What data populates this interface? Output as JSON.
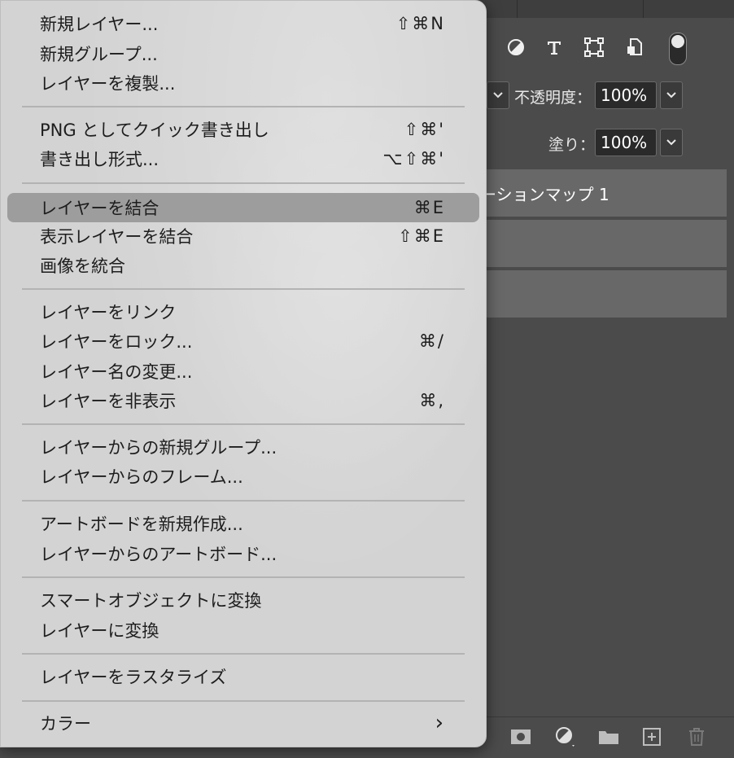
{
  "layers_panel": {
    "opacity_label": "不透明度：",
    "opacity_value": "100%",
    "fill_label": "塗り：",
    "fill_value": "100%",
    "layers": [
      {
        "name": "ーションマップ 1"
      },
      {
        "name": ""
      },
      {
        "name": ""
      }
    ],
    "filter_icons": [
      "adjustment-filter-icon",
      "type-filter-icon",
      "shape-filter-icon",
      "smart-object-filter-icon",
      "filter-toggle-icon"
    ],
    "bottom_icons": [
      "add-mask-icon",
      "new-adjustment-layer-icon",
      "new-group-icon",
      "new-layer-icon",
      "trash-icon"
    ]
  },
  "menu": {
    "items": [
      {
        "label": "新規レイヤー...",
        "shortcut": "⇧⌘N"
      },
      {
        "label": "新規グループ...",
        "shortcut": ""
      },
      {
        "label": "レイヤーを複製...",
        "shortcut": ""
      },
      {
        "label": "PNG としてクイック書き出し",
        "shortcut": "⇧⌘'"
      },
      {
        "label": "書き出し形式...",
        "shortcut": "⌥⇧⌘'"
      },
      {
        "label": "レイヤーを結合",
        "shortcut": "⌘E"
      },
      {
        "label": "表示レイヤーを結合",
        "shortcut": "⇧⌘E"
      },
      {
        "label": "画像を統合",
        "shortcut": ""
      },
      {
        "label": "レイヤーをリンク",
        "shortcut": ""
      },
      {
        "label": "レイヤーをロック...",
        "shortcut": "⌘/"
      },
      {
        "label": "レイヤー名の変更...",
        "shortcut": ""
      },
      {
        "label": "レイヤーを非表示",
        "shortcut": "⌘,"
      },
      {
        "label": "レイヤーからの新規グループ...",
        "shortcut": ""
      },
      {
        "label": "レイヤーからのフレーム...",
        "shortcut": ""
      },
      {
        "label": "アートボードを新規作成...",
        "shortcut": ""
      },
      {
        "label": "レイヤーからのアートボード...",
        "shortcut": ""
      },
      {
        "label": "スマートオブジェクトに変換",
        "shortcut": ""
      },
      {
        "label": "レイヤーに変換",
        "shortcut": ""
      },
      {
        "label": "レイヤーをラスタライズ",
        "shortcut": ""
      },
      {
        "label": "カラー",
        "shortcut": "›"
      }
    ],
    "highlighted_item": "レイヤーを結合"
  }
}
